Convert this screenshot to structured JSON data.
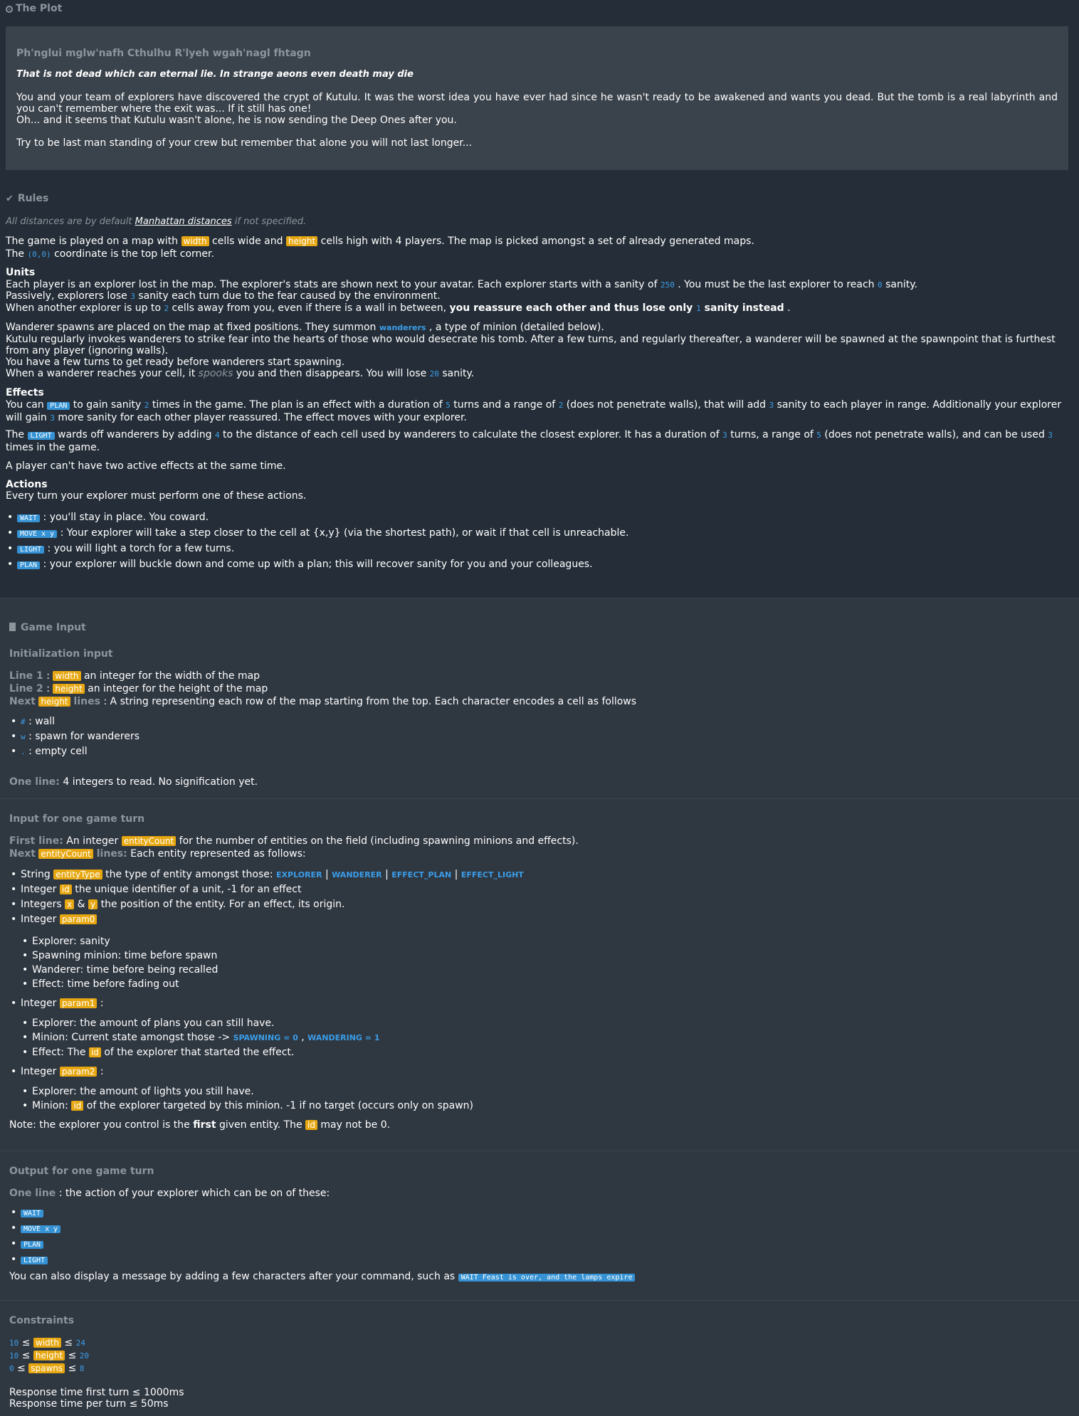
{
  "plot": {
    "title": "The Plot",
    "chant": "Ph'nglui mglw'nafh Cthulhu R'lyeh wgah'nagl fhtagn",
    "quote": "That is not dead which can eternal lie. In strange aeons even death may die",
    "para1": "You and your team of explorers have discovered the crypt of Kutulu. It was the worst idea you have ever had since he wasn't ready to be awakened and wants you dead. But the tomb is a real labyrinth and you can't remember where the exit was... If it still has one!",
    "para2": "Oh... and it seems that Kutulu wasn't alone, he is now sending the Deep Ones after you.",
    "para3": "Try to be last man standing of your crew but remember that alone you will not last longer..."
  },
  "rules": {
    "title": "Rules",
    "dist_a": "All distances are by default ",
    "dist_link": "Manhattan distances",
    "dist_b": " if not specified.",
    "map_a": "The game is played on a map with ",
    "map_width": "width",
    "map_b": " cells wide and ",
    "map_height": "height",
    "map_c": " cells high with 4 players. The map is picked amongst a set of already generated maps.",
    "coord_a": "The ",
    "coord_val": "(0,0)",
    "coord_b": " coordinate is the top left corner.",
    "units_title": "Units",
    "u1_a": "Each player is an explorer lost in the map. The explorer's stats are shown next to your avatar. Each explorer starts with a sanity of ",
    "u1_n": "250",
    "u1_b": " . You must be the last explorer to reach ",
    "u1_n2": "0",
    "u1_c": " sanity.",
    "u2_a": "Passively, explorers lose ",
    "u2_n": "3",
    "u2_b": " sanity each turn due to the fear caused by the environment.",
    "u3_a": "When another explorer is up to ",
    "u3_n": "2",
    "u3_b": " cells away from you, even if there is a wall in between, ",
    "u3_bold": "you reassure each other and thus lose only ",
    "u3_n2": "1",
    "u3_bold2": " sanity instead",
    "u3_c": " .",
    "w1_a": "Wanderer spawns are placed on the map at fixed positions. They summon ",
    "w1_kw": "wanderers",
    "w1_b": " , a type of minion (detailed below).",
    "w2": "Kutulu regularly invokes wanderers to strike fear into the hearts of those who would desecrate his tomb. After a few turns, and regularly thereafter, a wanderer will be spawned at the spawnpoint that is furthest from any player (ignoring walls).",
    "w3": "You have a few turns to get ready before wanderers start spawning.",
    "w4_a": "When a wanderer reaches your cell, it ",
    "w4_i": "spooks",
    "w4_b": " you and then disappears. You will lose ",
    "w4_n": "20",
    "w4_c": " sanity.",
    "effects_title": "Effects",
    "e1_a": "You can ",
    "e1_cmd": "PLAN",
    "e1_b": " to gain sanity ",
    "e1_n1": "2",
    "e1_c": " times in the game. The plan is an effect with a duration of ",
    "e1_n2": "5",
    "e1_d": " turns and a range of ",
    "e1_n3": "2",
    "e1_e": " (does not penetrate walls), that will add ",
    "e1_n4": "3",
    "e1_f": " sanity to each player in range. Additionally your explorer will gain ",
    "e1_n5": "3",
    "e1_g": " more sanity for each other player reassured. The effect moves with your explorer.",
    "e2_a": "The ",
    "e2_cmd": "LIGHT",
    "e2_b": " wards off wanderers by adding ",
    "e2_n1": "4",
    "e2_c": " to the distance of each cell used by wanderers to calculate the closest explorer. It has a duration of ",
    "e2_n2": "3",
    "e2_d": " turns, a range of ",
    "e2_n3": "5",
    "e2_e": " (does not penetrate walls), and can be used ",
    "e2_n4": "3",
    "e2_f": " times in the game.",
    "e3": "A player can't have two active effects at the same time.",
    "actions_title": "Actions",
    "actions_intro": "Every turn your explorer must perform one of these actions.",
    "actions": [
      {
        "cmd": "WAIT",
        "text": " : you'll stay in place. You coward."
      },
      {
        "cmd": "MOVE x y",
        "text": " : Your explorer will take a step closer to the cell at {x,y} (via the shortest path), or wait if that cell is unreachable."
      },
      {
        "cmd": "LIGHT",
        "text": " : you will light a torch for a few turns."
      },
      {
        "cmd": "PLAN",
        "text": " : your explorer will buckle down and come up with a plan; this will recover sanity for you and your colleagues."
      }
    ]
  },
  "input": {
    "title": "Game Input",
    "init_title": "Initialization input",
    "l1_label": "Line 1",
    "l1_sep": " : ",
    "l1_var": "width",
    "l1_text": " an integer for the width of the map",
    "l2_label": "Line 2",
    "l2_sep": " : ",
    "l2_var": "height",
    "l2_text": " an integer for the height of the map",
    "next_label": "Next",
    "next_var": "height",
    "next_lines": " lines",
    "next_text": " : A string representing each row of the map starting from the top. Each character encodes a cell as follows",
    "cells": [
      {
        "ch": "#",
        "text": " : wall"
      },
      {
        "ch": "w",
        "text": " : spawn for wanderers"
      },
      {
        "ch": ".",
        "text": " : empty cell"
      }
    ],
    "oneline_label": "One line:",
    "oneline_text": " 4 integers to read. No signification yet.",
    "turn_title": "Input for one game turn",
    "first_label": "First line:",
    "first_a": " An integer ",
    "first_var": "entityCount",
    "first_b": " for the number of entities on the field (including spawning minions and effects).",
    "next2_label": "Next",
    "next2_var": "entityCount",
    "next2_lines": " lines:",
    "next2_text": " Each entity represented as follows:",
    "ent1_a": "String ",
    "ent1_var": "entityType",
    "ent1_b": " the type of entity amongst those: ",
    "ent1_k1": "EXPLORER",
    "ent1_k2": "WANDERER",
    "ent1_k3": "EFFECT_PLAN",
    "ent1_k4": "EFFECT_LIGHT",
    "ent1_sep": " | ",
    "ent2_a": "Integer ",
    "ent2_var": "id",
    "ent2_b": " the unique identifier of a unit, -1 for an effect",
    "ent3_a": "Integers ",
    "ent3_v1": "x",
    "ent3_amp": " & ",
    "ent3_v2": "y",
    "ent3_b": " the position of the entity. For an effect, its origin.",
    "ent4_a": "Integer ",
    "ent4_var": "param0",
    "param0": [
      "Explorer: sanity",
      "Spawning minion: time before spawn",
      "Wanderer: time before being recalled",
      "Effect: time before fading out"
    ],
    "ent5_a": "Integer ",
    "ent5_var": "param1",
    "ent5_b": " :",
    "p1_1": "Explorer: the amount of plans you can still have.",
    "p1_2a": "Minion: Current state amongst those -> ",
    "p1_2k1": "SPAWNING = 0",
    "p1_2sep": " , ",
    "p1_2k2": "WANDERING = 1",
    "p1_3a": "Effect: The ",
    "p1_3var": "id",
    "p1_3b": " of the explorer that started the effect.",
    "ent6_a": "Integer ",
    "ent6_var": "param2",
    "ent6_b": " :",
    "p2_1": "Explorer: the amount of lights you still have.",
    "p2_2a": "Minion: ",
    "p2_2var": "id",
    "p2_2b": " of the explorer targeted by this minion. -1 if no target (occurs only on spawn)",
    "note_a": "Note: the explorer you control is the ",
    "note_bold": "first",
    "note_b": " given entity. The ",
    "note_var": "id",
    "note_c": " may not be 0."
  },
  "output": {
    "title": "Output for one game turn",
    "label": "One line",
    "text": " : the action of your explorer which can be on of these:",
    "cmds": [
      "WAIT",
      "MOVE x y",
      "PLAN",
      "LIGHT"
    ],
    "msg_a": "You can also display a message by adding a few characters after your command, such as ",
    "msg_cmd": "WAIT Feast is over, and the lamps expire"
  },
  "constraints": {
    "title": "Constraints",
    "rows": [
      {
        "lo": "10",
        "var": "width",
        "hi": "24"
      },
      {
        "lo": "10",
        "var": "height",
        "hi": "20"
      },
      {
        "lo": "0",
        "var": "spawns",
        "hi": "8"
      }
    ],
    "le": " ≤ ",
    "rt1": "Response time first turn ≤ 1000ms",
    "rt2": "Response time per turn ≤ 50ms"
  }
}
